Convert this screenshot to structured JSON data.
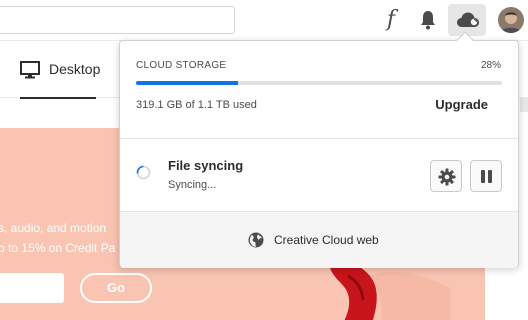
{
  "header": {
    "icons": [
      "font-icon",
      "bell-icon",
      "cloud-icon",
      "avatar"
    ],
    "font_glyph": "f"
  },
  "tabs": [
    {
      "label": "Desktop",
      "icon": "monitor-icon",
      "active": true
    }
  ],
  "banner": {
    "line1": "s, audio, and motion",
    "line2": "p to 15% on Credit Pa",
    "go_label": "Go",
    "color": "#f9c4b2"
  },
  "popover": {
    "storage": {
      "title": "CLOUD STORAGE",
      "percent_label": "28%",
      "percent": 28,
      "used_label": "319.1 GB of 1.1 TB used",
      "upgrade_label": "Upgrade",
      "accent": "#1473e6"
    },
    "sync": {
      "title": "File syncing",
      "status": "Syncing...",
      "icons": [
        "spinner-icon",
        "gear-icon",
        "pause-icon"
      ]
    },
    "footer": {
      "link_label": "Creative Cloud web",
      "icon": "globe-icon"
    }
  }
}
